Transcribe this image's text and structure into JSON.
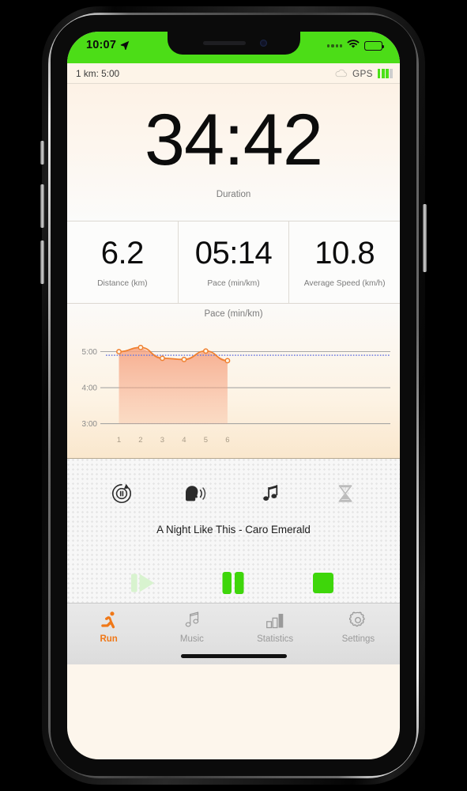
{
  "status_bar": {
    "time": "10:07",
    "location_icon": "location-arrow-icon",
    "wifi_icon": "wifi-icon",
    "battery_icon": "battery-full-icon",
    "background_color": "#4cdd17"
  },
  "sub_header": {
    "target_pace": "1 km: 5:00",
    "cloud_icon": "cloud-icon",
    "gps_label": "GPS",
    "gps_bars_total": 4,
    "gps_bars_active": 3
  },
  "duration": {
    "value": "34:42",
    "label": "Duration"
  },
  "stats": [
    {
      "value": "6.2",
      "label": "Distance (km)"
    },
    {
      "value": "05:14",
      "label": "Pace (min/km)"
    },
    {
      "value": "10.8",
      "label": "Average Speed (km/h)"
    }
  ],
  "chart_data": {
    "type": "line",
    "title": "Pace (min/km)",
    "xlabel": "",
    "ylabel": "",
    "x": [
      1,
      2,
      3,
      4,
      5,
      6
    ],
    "categories": [
      "1",
      "2",
      "3",
      "4",
      "5",
      "6"
    ],
    "values": [
      300,
      307,
      289,
      287,
      301,
      285
    ],
    "value_labels": [
      "5:00",
      "5:07",
      "4:49",
      "4:47",
      "5:01",
      "4:45"
    ],
    "series": [
      {
        "name": "Pace",
        "values": [
          300,
          307,
          289,
          287,
          301,
          285
        ]
      }
    ],
    "target_line": {
      "label": "5:00",
      "value": 294,
      "style": "dotted",
      "color": "#6c7ae0"
    },
    "ytick_labels": [
      "5:00",
      "4:00",
      "3:00"
    ],
    "ytick_values": [
      300,
      240,
      180
    ],
    "ylim": [
      170,
      330
    ],
    "xlim": [
      0.4,
      13.5
    ],
    "grid": true,
    "legend": "none",
    "line_color": "#f08030",
    "fill_color": "#f6a27f",
    "marker": "open-circle"
  },
  "controls": {
    "icons": [
      {
        "name": "auto-pause-icon",
        "label": "Auto Pause",
        "enabled": true
      },
      {
        "name": "voice-feedback-icon",
        "label": "Voice Feedback",
        "enabled": true
      },
      {
        "name": "music-note-icon",
        "label": "Music",
        "enabled": true
      },
      {
        "name": "hourglass-timer-icon",
        "label": "Interval Timer",
        "enabled": false
      }
    ],
    "song_title": "A Night Like This - Caro Emerald",
    "transport": [
      {
        "name": "resume-button",
        "icon": "resume-icon",
        "enabled": false,
        "color": "#d8f3cf"
      },
      {
        "name": "pause-button",
        "icon": "pause-icon",
        "enabled": true,
        "color": "#3ed60a"
      },
      {
        "name": "stop-button",
        "icon": "stop-icon",
        "enabled": true,
        "color": "#3ed60a"
      }
    ]
  },
  "tab_bar": {
    "active_color": "#f07818",
    "inactive_color": "#9a9a9a",
    "items": [
      {
        "label": "Run",
        "icon": "running-person-icon",
        "active": true
      },
      {
        "label": "Music",
        "icon": "music-notes-icon",
        "active": false
      },
      {
        "label": "Statistics",
        "icon": "bar-chart-icon",
        "active": false
      },
      {
        "label": "Settings",
        "icon": "gear-icon",
        "active": false
      }
    ]
  }
}
